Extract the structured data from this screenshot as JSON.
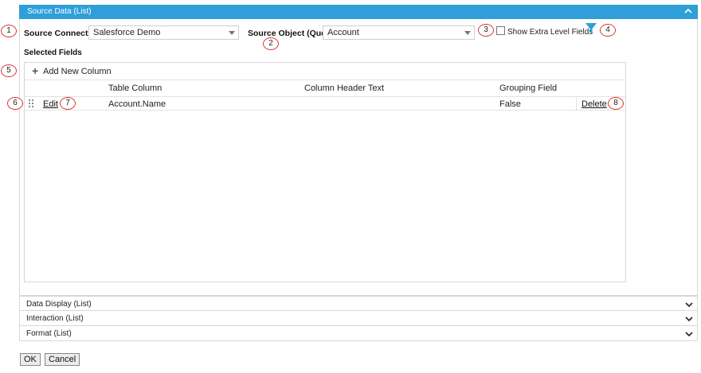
{
  "source_panel": {
    "title": "Source Data (List)",
    "expanded": true
  },
  "source_connection": {
    "label": "Source Connection",
    "value": "Salesforce Demo"
  },
  "source_object": {
    "label": "Source Object (Query)",
    "value": "Account"
  },
  "extra_level": {
    "label": "Show Extra Level Fields",
    "checked": false
  },
  "filter_icon": {
    "icon": "filter-icon",
    "color": "#2e9fd8"
  },
  "selected_fields_label": "Selected Fields",
  "grid": {
    "add_label": "Add New Column",
    "columns": [
      "Table Column",
      "Column Header Text",
      "Grouping Field"
    ],
    "rows": [
      {
        "edit": "Edit",
        "table_column": "Account.Name",
        "column_header_text": "",
        "grouping_field": "False",
        "delete": "Delete"
      }
    ]
  },
  "collapsed_panels": [
    {
      "title": "Data Display (List)"
    },
    {
      "title": "Interaction (List)"
    },
    {
      "title": "Format (List)"
    }
  ],
  "buttons": {
    "ok": "OK",
    "cancel": "Cancel"
  },
  "callouts": [
    "1",
    "2",
    "3",
    "4",
    "5",
    "6",
    "7",
    "8"
  ],
  "colors": {
    "header_blue": "#2e9fd8",
    "callout_red": "#d9342b"
  }
}
